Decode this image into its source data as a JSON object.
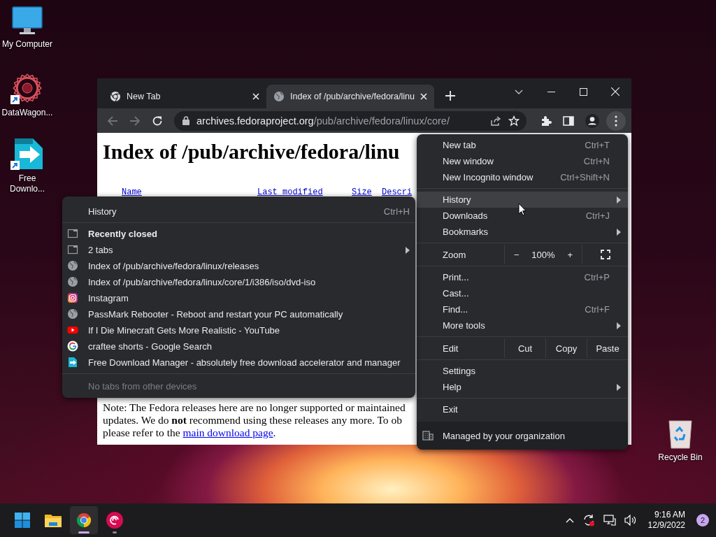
{
  "desktop_icons": [
    {
      "label": "My Computer",
      "kind": "monitor",
      "shortcut": false
    },
    {
      "label": "DataWagon...",
      "kind": "datawagon",
      "shortcut": true
    },
    {
      "label": "Free Downlo...",
      "kind": "fdm",
      "shortcut": true
    }
  ],
  "recycle_bin": {
    "label": "Recycle Bin"
  },
  "browser": {
    "tabs": [
      {
        "title": "New Tab",
        "kind": "chrome",
        "selected": false
      },
      {
        "title": "Index of /pub/archive/fedora/linu",
        "kind": "globe",
        "selected": true
      }
    ],
    "url": {
      "host": "archives.fedoraproject.org",
      "path": "/pub/archive/fedora/linux/core/"
    },
    "page": {
      "heading": "Index of /pub/archive/fedora/linu",
      "columns": [
        "Name",
        "Last modified",
        "Size",
        "Descri"
      ],
      "note_lines": [
        "Note: The Fedora releases here are no longer supported or maintained",
        "updates. We do **not** recommend using these releases any more. To ob"
      ],
      "note_last": {
        "before": "please refer to the ",
        "link": "main download page",
        "after": "."
      }
    }
  },
  "menu": {
    "groups": [
      [
        {
          "kind": "item",
          "label": "New tab",
          "shortcut": "Ctrl+T",
          "submenu": false,
          "highlighted": false
        },
        {
          "kind": "item",
          "label": "New window",
          "shortcut": "Ctrl+N",
          "submenu": false,
          "highlighted": false
        },
        {
          "kind": "item",
          "label": "New Incognito window",
          "shortcut": "Ctrl+Shift+N",
          "submenu": false,
          "highlighted": false
        }
      ],
      [
        {
          "kind": "item",
          "label": "History",
          "submenu": true,
          "highlighted": true
        },
        {
          "kind": "item",
          "label": "Downloads",
          "shortcut": "Ctrl+J",
          "submenu": false,
          "highlighted": false
        },
        {
          "kind": "item",
          "label": "Bookmarks",
          "submenu": true,
          "highlighted": false
        }
      ],
      [
        {
          "kind": "zoom",
          "label": "Zoom",
          "minus": "−",
          "reading": "100%",
          "plus": "+"
        }
      ],
      [
        {
          "kind": "item",
          "label": "Print...",
          "shortcut": "Ctrl+P",
          "submenu": false,
          "highlighted": false
        },
        {
          "kind": "item",
          "label": "Cast...",
          "submenu": false,
          "highlighted": false
        },
        {
          "kind": "item",
          "label": "Find...",
          "shortcut": "Ctrl+F",
          "submenu": false,
          "highlighted": false
        },
        {
          "kind": "item",
          "label": "More tools",
          "submenu": true,
          "highlighted": false
        }
      ],
      [
        {
          "kind": "edit",
          "label": "Edit",
          "buttons": [
            "Cut",
            "Copy",
            "Paste"
          ]
        }
      ],
      [
        {
          "kind": "item",
          "label": "Settings",
          "submenu": false,
          "highlighted": false
        },
        {
          "kind": "item",
          "label": "Help",
          "submenu": true,
          "highlighted": false
        }
      ],
      [
        {
          "kind": "item",
          "label": "Exit",
          "submenu": false,
          "highlighted": false
        }
      ]
    ],
    "managed": "Managed by your organization"
  },
  "history_menu": {
    "header": {
      "label": "History",
      "shortcut": "Ctrl+H"
    },
    "rows": [
      {
        "kind": "heading",
        "label": "Recently closed",
        "submenu": false
      },
      {
        "kind": "window",
        "label": "2 tabs",
        "submenu": true
      },
      {
        "kind": "globe",
        "label": "Index of /pub/archive/fedora/linux/releases",
        "submenu": false
      },
      {
        "kind": "globe",
        "label": "Index of /pub/archive/fedora/linux/core/1/i386/iso/dvd-iso",
        "submenu": false
      },
      {
        "kind": "instagram",
        "label": "Instagram",
        "submenu": false
      },
      {
        "kind": "globe",
        "label": "PassMark Rebooter - Reboot and restart your PC automatically",
        "submenu": false
      },
      {
        "kind": "youtube",
        "label": "If I Die Minecraft Gets More Realistic - YouTube",
        "submenu": false
      },
      {
        "kind": "google",
        "label": "craftee shorts - Google Search",
        "submenu": false
      },
      {
        "kind": "fdm",
        "label": "Free Download Manager - absolutely free download accelerator and manager",
        "submenu": false
      }
    ],
    "footer": "No tabs from other devices"
  },
  "taskbar": {
    "apps": [
      {
        "kind": "start",
        "running": false,
        "active": false
      },
      {
        "kind": "explorer",
        "running": false,
        "active": false
      },
      {
        "kind": "chrome",
        "running": true,
        "active": true
      },
      {
        "kind": "debian",
        "running": true,
        "active": false
      }
    ],
    "time": "9:16 AM",
    "date": "12/9/2022",
    "notification_count": "2"
  }
}
